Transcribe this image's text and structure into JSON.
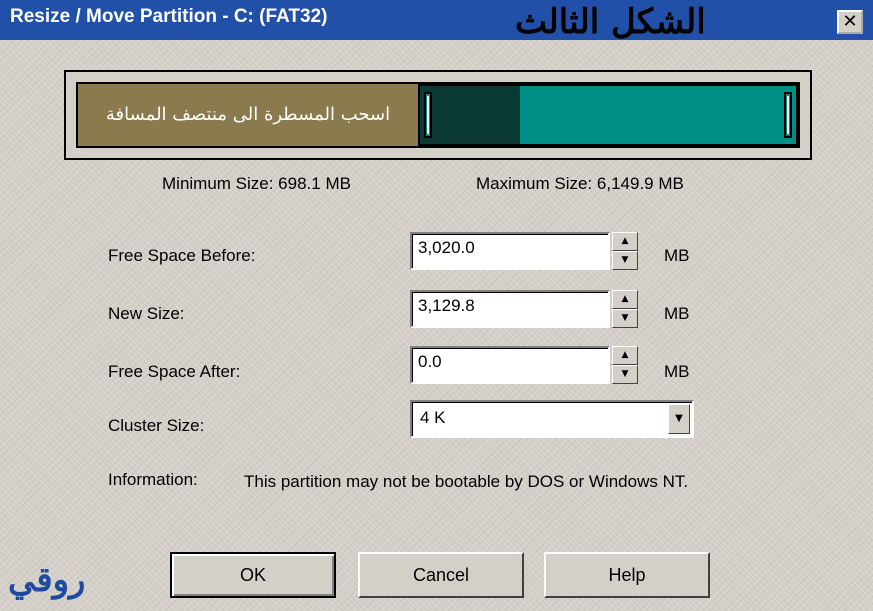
{
  "window": {
    "title": "Resize / Move Partition - C: (FAT32)",
    "arabic_heading": "الشكل الثالث",
    "close_symbol": "✕"
  },
  "partition_bar": {
    "instruction": "اسحب المسطرة الى منتصف المسافة",
    "colors": {
      "free_before": "#8b7a4d",
      "used": "#0a3a33",
      "free_in_partition": "#008f86"
    }
  },
  "sizes": {
    "minimum": "Minimum Size:  698.1 MB",
    "maximum": "Maximum Size:  6,149.9 MB"
  },
  "fields": {
    "free_before": {
      "label": "Free Space Before:",
      "value": "3,020.0",
      "unit": "MB"
    },
    "new_size": {
      "label": "New Size:",
      "value": "3,129.8",
      "unit": "MB"
    },
    "free_after": {
      "label": "Free Space After:",
      "value": "0.0",
      "unit": "MB"
    },
    "cluster": {
      "label": "Cluster Size:",
      "value": "4 K"
    }
  },
  "spinner_icons": {
    "up": "▲",
    "down": "▼"
  },
  "dropdown_icon": "▼",
  "information": {
    "label": "Information:",
    "text": "This partition may not be bootable by DOS or Windows NT."
  },
  "buttons": {
    "ok": "OK",
    "cancel": "Cancel",
    "help": "Help"
  },
  "watermark": "روقي"
}
